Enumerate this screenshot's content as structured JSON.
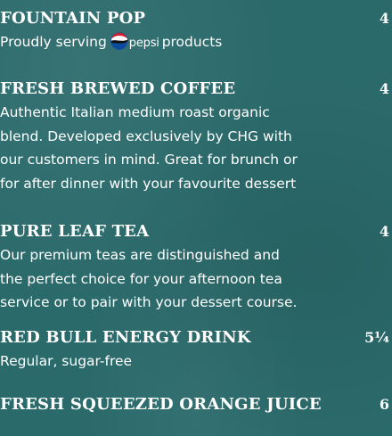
{
  "menu": {
    "items": [
      {
        "name": "FOUNTAIN POP",
        "price": "4",
        "desc_before_logo": "Proudly serving",
        "logo_word": "pepsi",
        "desc_after_logo": "products",
        "logo_icon": "pepsi-globe-icon"
      },
      {
        "name": "FRESH BREWED COFFEE",
        "price": "4",
        "desc_lines": [
          "Authentic Italian medium roast organic",
          "blend. Developed exclusively by CHG with",
          "our customers in mind. Great for brunch or",
          "for after dinner with your favourite dessert"
        ]
      },
      {
        "name": "PURE LEAF TEA",
        "price": "4",
        "desc_lines": [
          "Our premium teas are distinguished and",
          "the perfect choice for your afternoon tea",
          "service or to pair with your dessert course."
        ]
      },
      {
        "name": "RED BULL ENERGY DRINK",
        "price": "5¼",
        "desc_lines": [
          "Regular, sugar-free"
        ]
      },
      {
        "name": "FRESH SQUEEZED ORANGE JUICE",
        "price": "6"
      }
    ]
  },
  "colors": {
    "background": "#2b6a6b",
    "text": "#ffffff",
    "pepsi_blue": "#0b4a9c",
    "pepsi_red": "#d2202f"
  }
}
